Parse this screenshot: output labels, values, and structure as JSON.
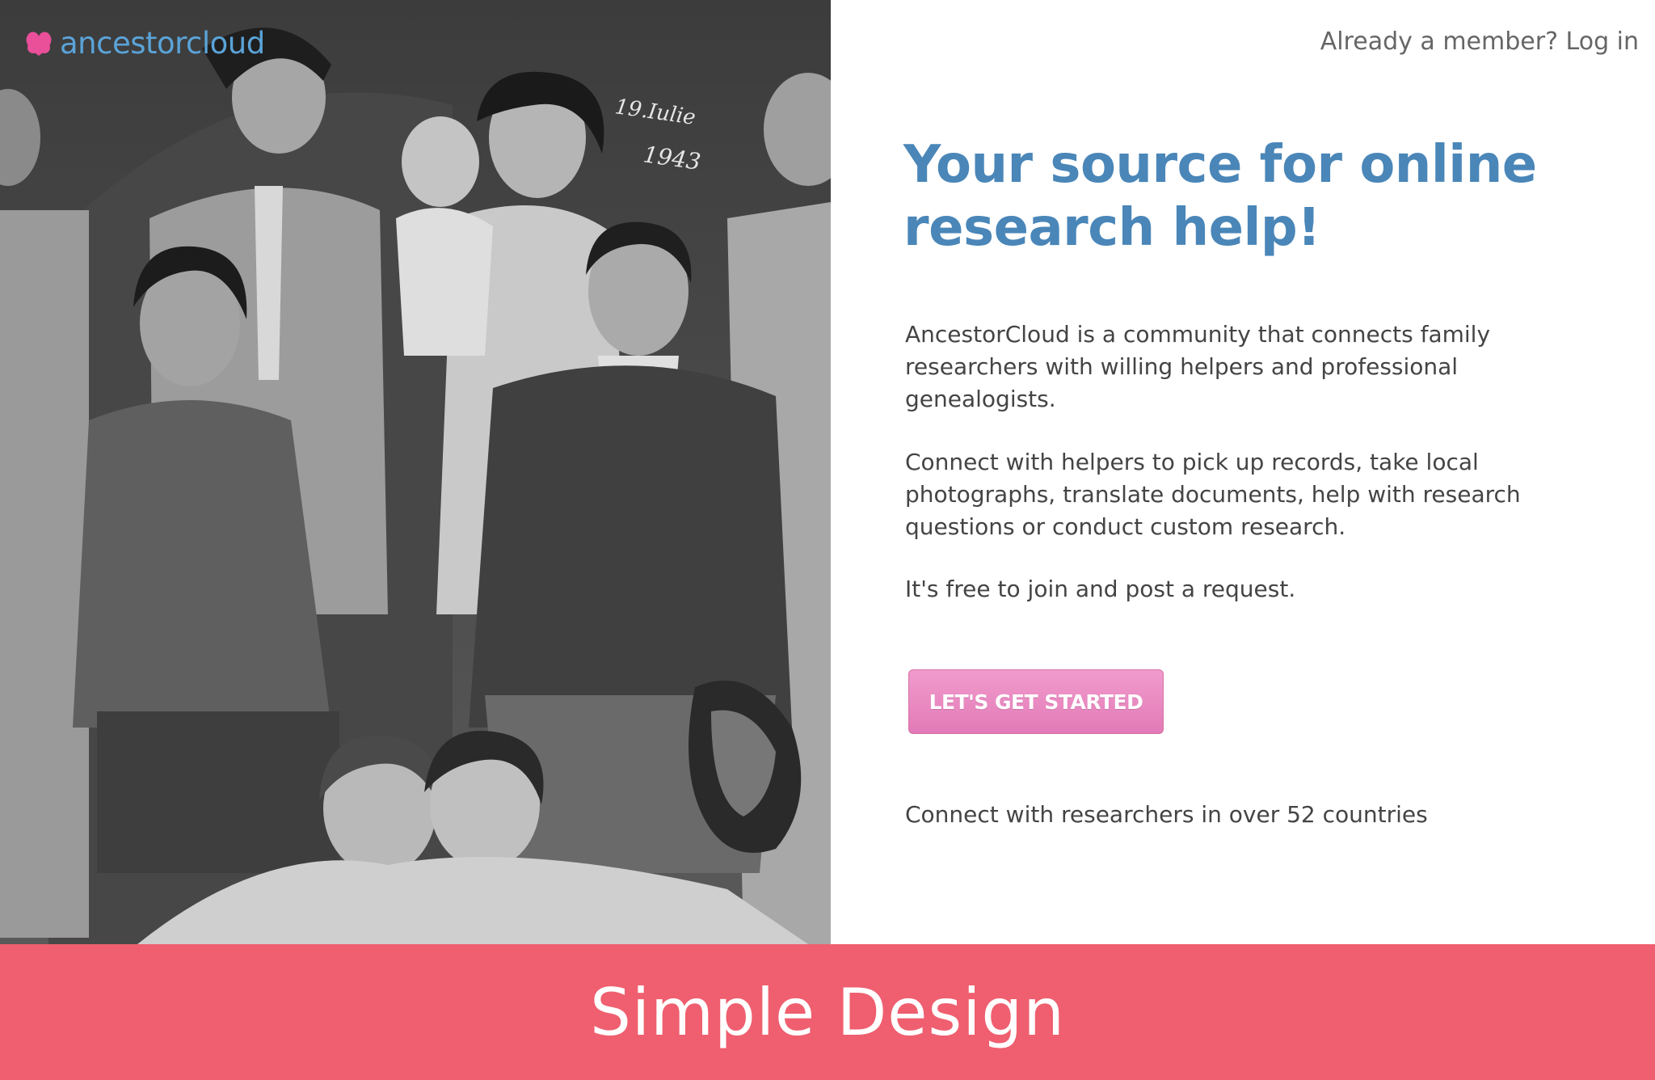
{
  "brand": {
    "logo_text": "ancestorcloud",
    "logo_color": "#5aa3d8",
    "accent_pink": "#ea4f9a"
  },
  "header": {
    "login_text": "Already a member? Log in"
  },
  "hero": {
    "headline": "Your source for online research help!",
    "paragraph_1": "AncestorCloud is a community that connects family researchers with willing helpers and professional genealogists.",
    "paragraph_2": "Connect with helpers to pick up records, take local photographs, translate documents, help with research questions or conduct custom research.",
    "paragraph_3": "It's free to join and post a request.",
    "cta_label": "LET'S GET STARTED",
    "countries_text": "Connect with researchers in over 52 countries"
  },
  "photo": {
    "inscription_line_1": "19.Iulie",
    "inscription_line_2": "1943",
    "description_icon": "family-photo"
  },
  "banner": {
    "caption": "Simple Design",
    "color": "#ef5f6f"
  }
}
